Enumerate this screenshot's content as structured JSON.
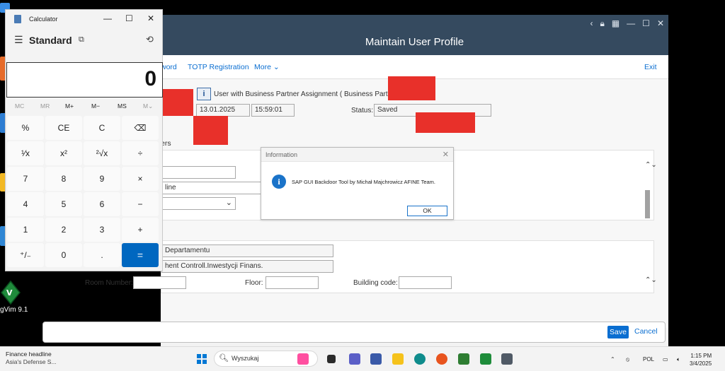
{
  "desktop": {
    "vim_label": "gVim 9.1"
  },
  "sap": {
    "title": "Maintain User Profile",
    "toolbar": {
      "change_password": "word",
      "totp": "TOTP Registration",
      "more": "More",
      "exit": "Exit"
    },
    "header": {
      "bp_label": "User with Business Partner Assignment ( Business Partner:",
      "date": "13.01.2025",
      "time": "15:59:01",
      "status_label": "Status:",
      "status_value": "Saved",
      "section_fragment": "ers"
    },
    "form": {
      "fragment_line": "line",
      "department": "Departamentu",
      "function": "hent Controll.Inwestycji Finans.",
      "room_label": "Room Number:",
      "floor_label": "Floor:",
      "building_label": "Building code:"
    },
    "footer": {
      "save": "Save",
      "cancel": "Cancel"
    }
  },
  "dialog": {
    "title": "Information",
    "message": "SAP GUI Backdoor Tool by Michał Majchrowicz AFINE Team.",
    "ok": "OK"
  },
  "calculator": {
    "window_title": "Calculator",
    "mode": "Standard",
    "display": "0",
    "memory": [
      "MC",
      "MR",
      "M+",
      "M−",
      "MS",
      "M⌄"
    ],
    "keys": [
      [
        "%",
        "CE",
        "C",
        "⌫"
      ],
      [
        "¹⁄x",
        "x²",
        "²√x",
        "÷"
      ],
      [
        "7",
        "8",
        "9",
        "×"
      ],
      [
        "4",
        "5",
        "6",
        "−"
      ],
      [
        "1",
        "2",
        "3",
        "+"
      ],
      [
        "⁺/₋",
        "0",
        ".",
        "="
      ]
    ]
  },
  "taskbar": {
    "news_title": "Finance headline",
    "news_sub": "Asia's Defense S...",
    "search_placeholder": "Wyszukaj",
    "lang": "POL",
    "time": "1:15 PM",
    "date": "3/4/2025"
  },
  "colors": {
    "sap_header": "#354a5f",
    "sap_link": "#0a6ed1",
    "redaction": "#e8302a",
    "calc_equals": "#0067c0"
  }
}
